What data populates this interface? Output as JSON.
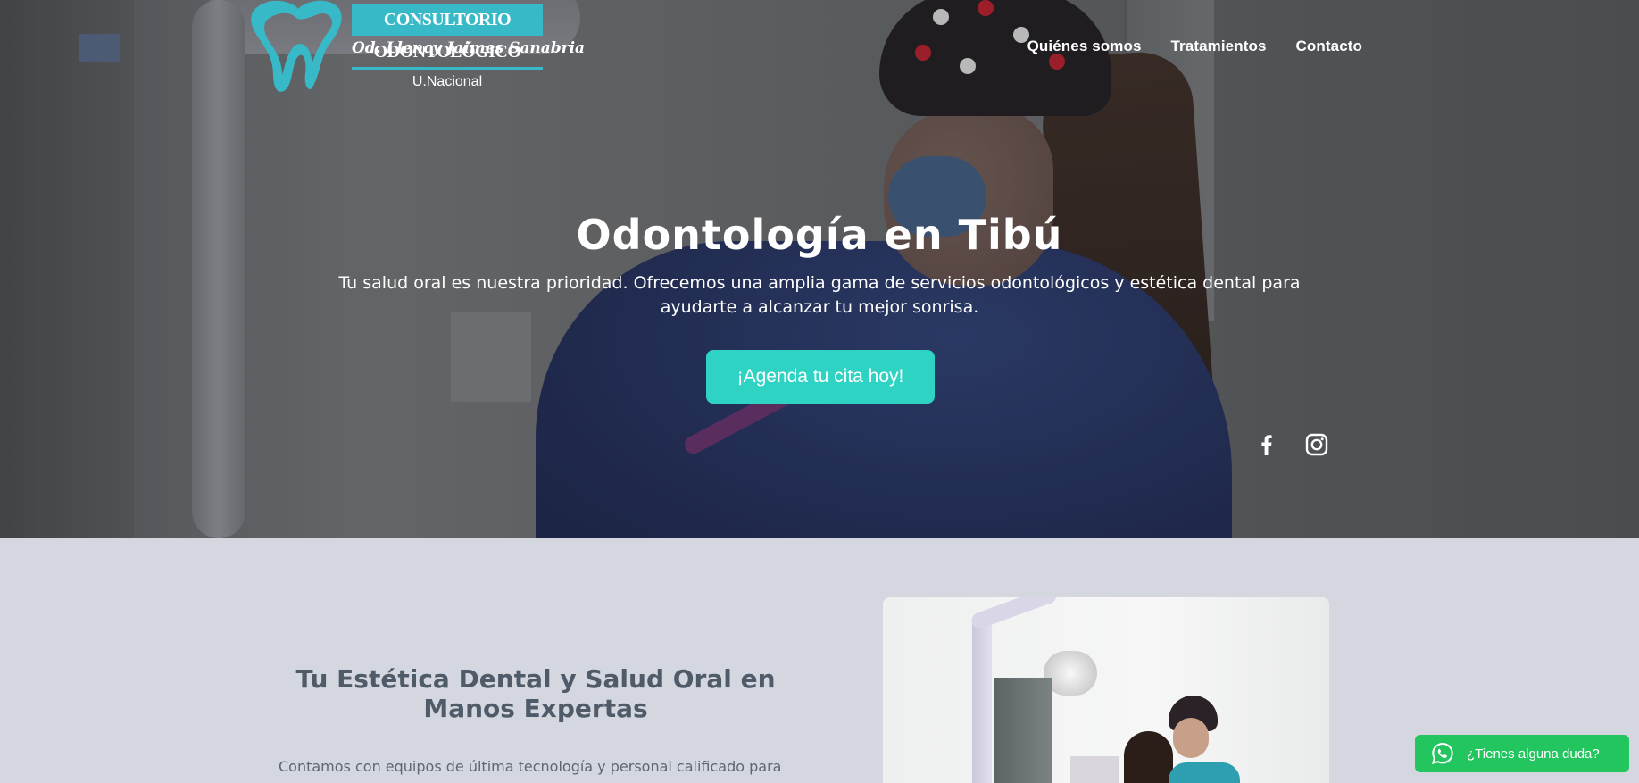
{
  "brand": {
    "name": "CONSULTORIO ODONTOLÓGICO",
    "doctor": "Od. Llency Jaimes Sanabria",
    "university": "U.Nacional",
    "accent": "#37b9c7"
  },
  "nav": {
    "items": [
      "Quiénes somos",
      "Tratamientos",
      "Contacto"
    ]
  },
  "hero": {
    "title": "Odontología en Tibú",
    "subtitle": "Tu salud oral es nuestra prioridad. Ofrecemos una amplia gama de servicios odontológicos y estética dental para ayudarte a alcanzar tu mejor sonrisa.",
    "cta": "¡Agenda tu cita hoy!",
    "cta_color": "#2fd3c3"
  },
  "social": {
    "icons": [
      "facebook-icon",
      "instagram-icon"
    ]
  },
  "about": {
    "title": "Tu Estética Dental y Salud Oral en Manos Expertas",
    "text": "Contamos con equipos de última tecnología y personal calificado para"
  },
  "whatsapp": {
    "label": "¿Tienes alguna duda?",
    "icon": "whatsapp-icon",
    "color": "#22c55e"
  }
}
